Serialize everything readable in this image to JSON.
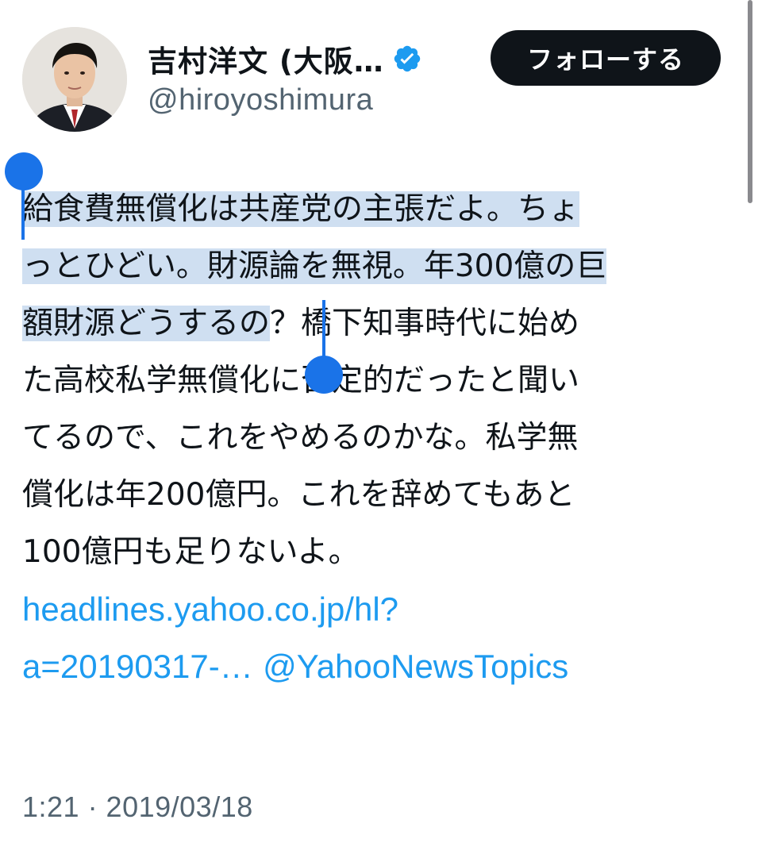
{
  "tweet": {
    "author": {
      "display_name": "吉村洋文 (大阪…",
      "handle": "@hiroyoshimura",
      "verified": true,
      "verified_icon": "verified-badge-icon",
      "avatar_icon": "avatar-photo"
    },
    "follow_button_label": "フォローする",
    "text_lines": [
      {
        "selected": "給食費無償化は共産党の主張だよ。ちょ",
        "rest": ""
      },
      {
        "selected": "っとひどい。財源論を無視。年300億の巨",
        "rest": ""
      },
      {
        "selected": "額財源どうするの",
        "rest": "？橋下知事時代に始め"
      },
      {
        "selected": "",
        "rest": "た高校私学無償化に否定的だったと聞い"
      },
      {
        "selected": "",
        "rest": "てるので、これをやめるのかな。私学無"
      },
      {
        "selected": "",
        "rest": "償化は年200億円。これを辞めてもあと"
      },
      {
        "selected": "",
        "rest": "100億円も足りないよ。"
      }
    ],
    "link_line1": "headlines.yahoo.co.jp/hl?",
    "link_line2": "a=20190317-…",
    "mention": "@YahooNewsTopics",
    "timestamp": "1:21 · 2019/03/18"
  },
  "colors": {
    "link": "#1d9bf0",
    "selection": "#cfdff1",
    "selection_handle": "#1a73e8",
    "follow_bg": "#0f1419",
    "secondary_text": "#536471"
  }
}
